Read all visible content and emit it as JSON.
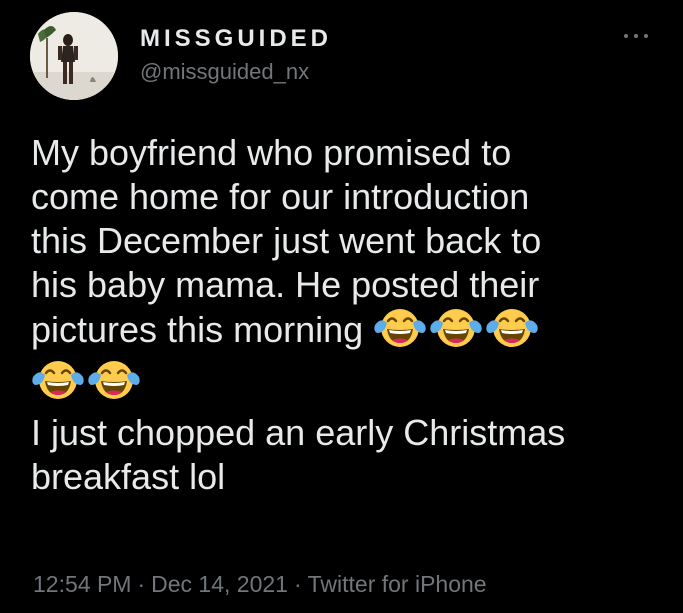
{
  "author": {
    "display_name": "MISSGUIDED",
    "handle": "@missguided_nx"
  },
  "menu": {
    "icon": "more-horizontal-icon"
  },
  "tweet": {
    "line1": "My boyfriend who promised to",
    "line2": "come home for our introduction",
    "line3": "this December just went back to",
    "line4": "his baby mama. He posted their",
    "line5": "pictures this morning",
    "line5_emoji_count": 3,
    "line6_emoji_count": 2,
    "emoji_name": "face-with-tears-of-joy",
    "line7": "I just chopped an early Christmas",
    "line8": "breakfast lol"
  },
  "meta": {
    "time": "12:54 PM",
    "separator": "·",
    "date": "Dec 14, 2021",
    "source": "Twitter for iPhone"
  },
  "colors": {
    "background": "#000000",
    "primary_text": "#e7e9ea",
    "secondary_text": "#71767b",
    "emoji_face": "#ffcc4d",
    "emoji_tears": "#5dadec"
  }
}
